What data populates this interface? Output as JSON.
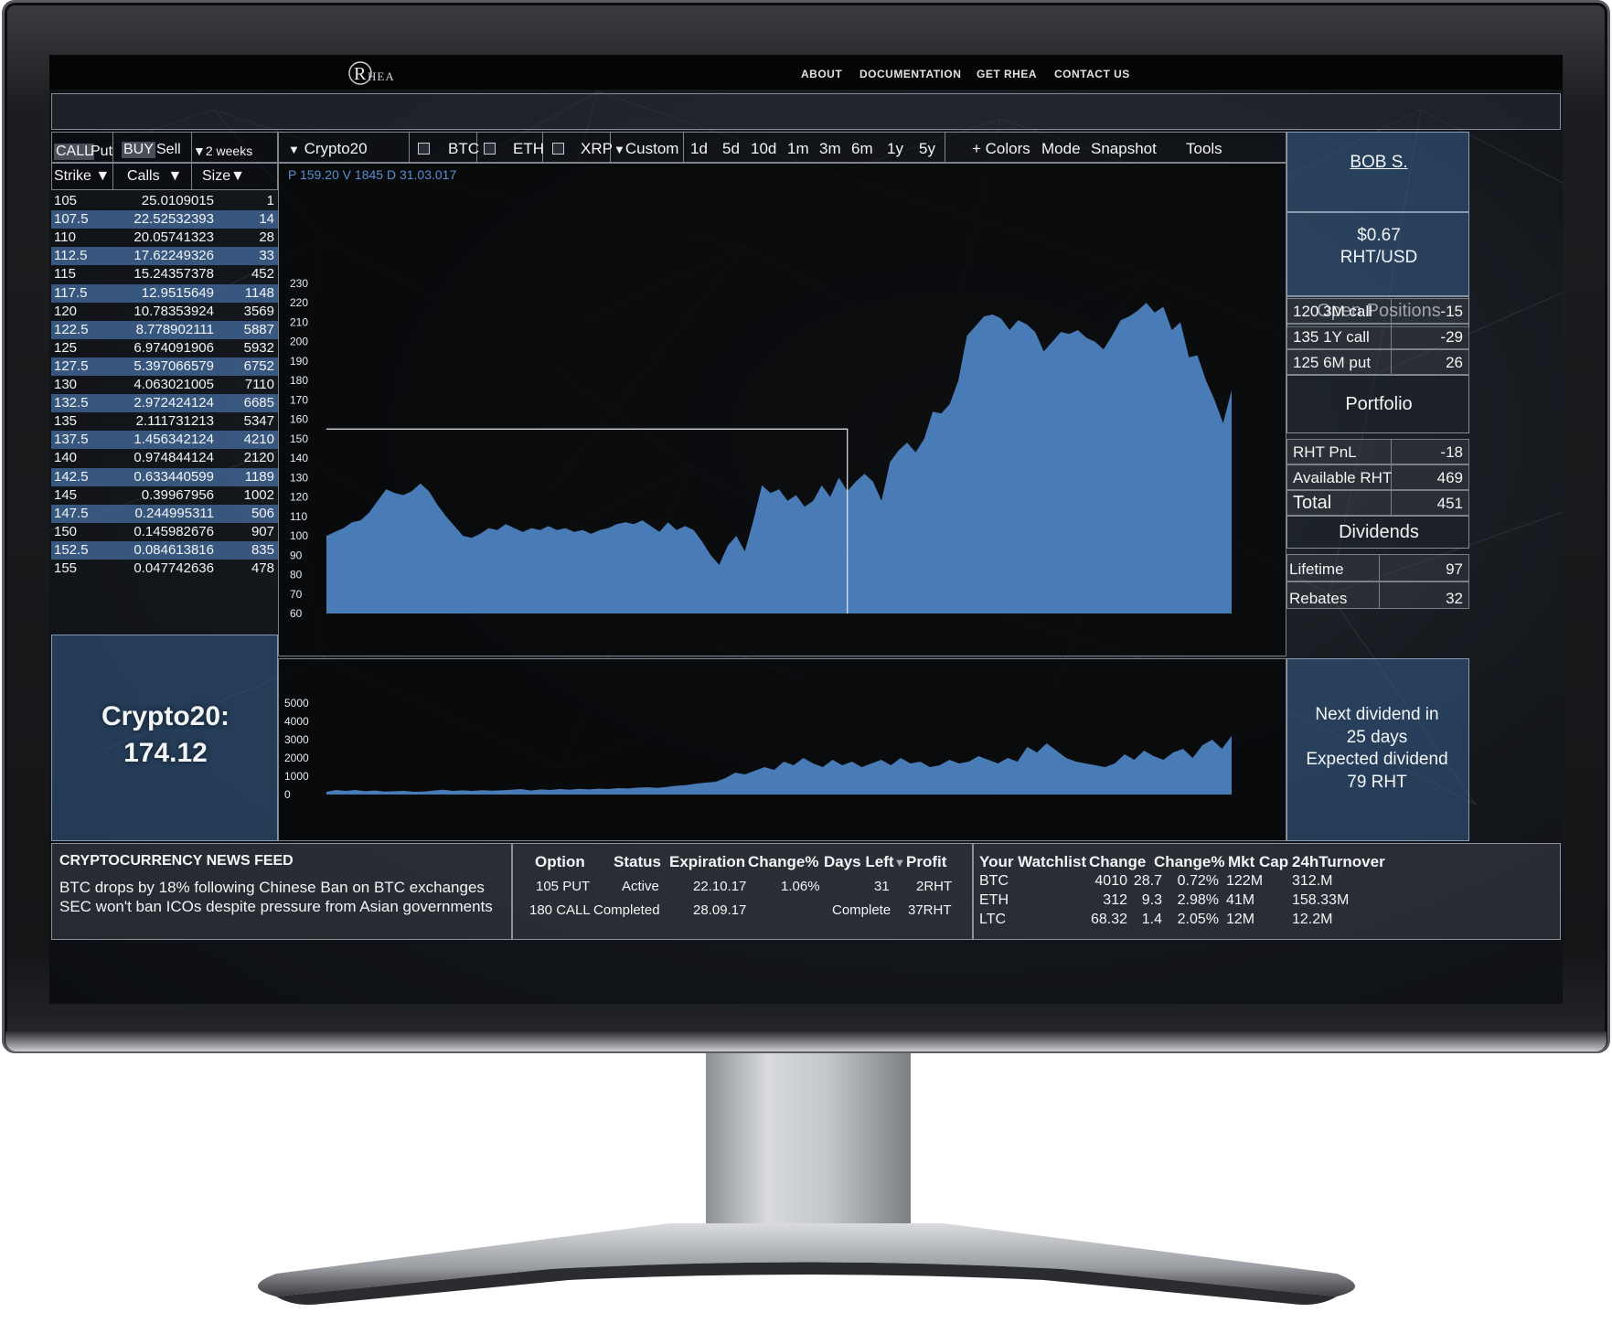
{
  "nav": {
    "logo_text": "HEA",
    "links": [
      "ABOUT",
      "DOCUMENTATION",
      "GET RHEA",
      "CONTACT US"
    ]
  },
  "chain": {
    "tabs": {
      "call": "CALL",
      "put": "Put",
      "buy": "BUY",
      "sell": "Sell",
      "expiry": "2 weeks"
    },
    "headers": {
      "strike": "Strike",
      "calls": "Calls",
      "size": "Size"
    },
    "rows": [
      [
        "105",
        "25.0109015",
        "1"
      ],
      [
        "107.5",
        "22.52532393",
        "14"
      ],
      [
        "110",
        "20.05741323",
        "28"
      ],
      [
        "112.5",
        "17.62249326",
        "33"
      ],
      [
        "115",
        "15.24357378",
        "452"
      ],
      [
        "117.5",
        "12.9515649",
        "1148"
      ],
      [
        "120",
        "10.78353924",
        "3569"
      ],
      [
        "122.5",
        "8.778902111",
        "5887"
      ],
      [
        "125",
        "6.974091906",
        "5932"
      ],
      [
        "127.5",
        "5.397066579",
        "6752"
      ],
      [
        "130",
        "4.063021005",
        "7110"
      ],
      [
        "132.5",
        "2.972424124",
        "6685"
      ],
      [
        "135",
        "2.111731213",
        "5347"
      ],
      [
        "137.5",
        "1.456342124",
        "4210"
      ],
      [
        "140",
        "0.974844124",
        "2120"
      ],
      [
        "142.5",
        "0.633440599",
        "1189"
      ],
      [
        "145",
        "0.39967956",
        "1002"
      ],
      [
        "147.5",
        "0.244995311",
        "506"
      ],
      [
        "150",
        "0.145982676",
        "907"
      ],
      [
        "152.5",
        "0.084613816",
        "835"
      ],
      [
        "155",
        "0.047742636",
        "478"
      ]
    ],
    "index_label": "Crypto20:",
    "index_value": "174.12"
  },
  "toolbar": {
    "asset": "Crypto20",
    "checks": [
      "BTC",
      "ETH",
      "XRP"
    ],
    "range_custom": "Custom",
    "ranges": [
      "1d",
      "5d",
      "10d",
      "1m",
      "3m",
      "6m",
      "1y",
      "5y"
    ],
    "actions": [
      "+ Colors",
      "Mode",
      "Snapshot",
      "Tools"
    ]
  },
  "chart_info": {
    "text": "P 159.20  V 1845   D  31.03.017"
  },
  "chart_data": [
    {
      "type": "area",
      "ylim": [
        60,
        230
      ],
      "yticks": [
        230,
        220,
        210,
        200,
        190,
        180,
        170,
        160,
        150,
        140,
        130,
        120,
        110,
        100,
        90,
        80,
        70,
        60
      ],
      "values": [
        100,
        102,
        104,
        107,
        108,
        112,
        118,
        124,
        122,
        121,
        123,
        127,
        123,
        116,
        110,
        105,
        100,
        99,
        101,
        104,
        103,
        106,
        104,
        102,
        104,
        103,
        105,
        103,
        104,
        102,
        103,
        101,
        103,
        104,
        106,
        107,
        106,
        108,
        105,
        102,
        107,
        103,
        105,
        103,
        97,
        90,
        85,
        95,
        100,
        92,
        108,
        126,
        122,
        124,
        118,
        121,
        115,
        118,
        126,
        120,
        130,
        123,
        128,
        132,
        128,
        118,
        138,
        144,
        148,
        143,
        150,
        164,
        163,
        168,
        180,
        203,
        208,
        213,
        214,
        212,
        206,
        211,
        209,
        205,
        195,
        200,
        205,
        204,
        206,
        202,
        200,
        196,
        203,
        211,
        213,
        216,
        220,
        215,
        218,
        206,
        210,
        192,
        193,
        180,
        170,
        158,
        175
      ]
    },
    {
      "type": "area",
      "ylim": [
        0,
        5000
      ],
      "yticks": [
        5000,
        4000,
        3000,
        2000,
        1000,
        0
      ],
      "values": [
        150,
        250,
        200,
        250,
        180,
        220,
        160,
        180,
        200,
        150,
        160,
        220,
        260,
        200,
        230,
        200,
        240,
        210,
        230,
        260,
        300,
        220,
        280,
        250,
        300,
        260,
        310,
        280,
        320,
        300,
        350,
        330,
        380,
        400,
        360,
        420,
        480,
        520,
        600,
        650,
        700,
        900,
        1200,
        1100,
        1300,
        1500,
        1350,
        1800,
        1600,
        2000,
        1700,
        1500,
        1900,
        1600,
        1800,
        1500,
        1700,
        1900,
        1600,
        2000,
        1700,
        1800,
        1500,
        1600,
        1900,
        1700,
        1800,
        2100,
        1900,
        1700,
        2000,
        1800,
        2600,
        2300,
        2800,
        2400,
        2000,
        1800,
        1700,
        1600,
        1500,
        1700,
        2200,
        1900,
        2400,
        2100,
        1900,
        2300,
        2500,
        2000,
        2700,
        3000,
        2500,
        3200
      ]
    }
  ],
  "user": {
    "name": "BOB S."
  },
  "rht": {
    "price": "$0.67",
    "pair": "RHT/USD"
  },
  "positions": {
    "title": "Open Positions",
    "items": [
      [
        "120 3M call",
        "-15"
      ],
      [
        "135 1Y call",
        "-29"
      ],
      [
        "125 6M put",
        "26"
      ]
    ]
  },
  "portfolio": {
    "title": "Portfolio",
    "items": [
      [
        "RHT PnL",
        "-18"
      ],
      [
        "Available RHT",
        "469"
      ],
      [
        "Total",
        "451"
      ]
    ]
  },
  "dividends": {
    "title": "Dividends",
    "items": [
      [
        "Lifetime",
        "97"
      ],
      [
        "Rebates",
        "32"
      ]
    ],
    "next_line1": "Next dividend in",
    "next_line2": "25 days",
    "expected_line1": "Expected dividend",
    "expected_line2": "79 RHT"
  },
  "news": {
    "title": "CRYPTOCURRENCY NEWS FEED",
    "items": [
      "BTC drops by 18% following Chinese Ban on BTC exchanges",
      "SEC won't ban ICOs despite pressure from Asian governments"
    ]
  },
  "orders": {
    "headers": [
      "Option",
      "Status",
      "Expiration",
      "Change%",
      "Days Left",
      "Profit"
    ],
    "rows": [
      [
        "105 PUT",
        "Active",
        "22.10.17",
        "1.06%",
        "31",
        "2RHT"
      ],
      [
        "180 CALL",
        "Completed",
        "28.09.17",
        "",
        "Complete",
        "37RHT"
      ]
    ]
  },
  "watchlist": {
    "headers": [
      "Your Watchlist",
      "Change",
      "Change%",
      "Mkt Cap",
      "24hTurnover"
    ],
    "rows": [
      [
        "BTC",
        "4010",
        "28.7",
        "0.72%",
        "122M",
        "312.M"
      ],
      [
        "ETH",
        "312",
        "9.3",
        "2.98%",
        "41M",
        "158.33M"
      ],
      [
        "LTC",
        "68.32",
        "1.4",
        "2.05%",
        "12M",
        "12.2M"
      ]
    ]
  },
  "colors": {
    "accent_blue": "#4f86c6",
    "panel_blue": "#375f8c"
  }
}
